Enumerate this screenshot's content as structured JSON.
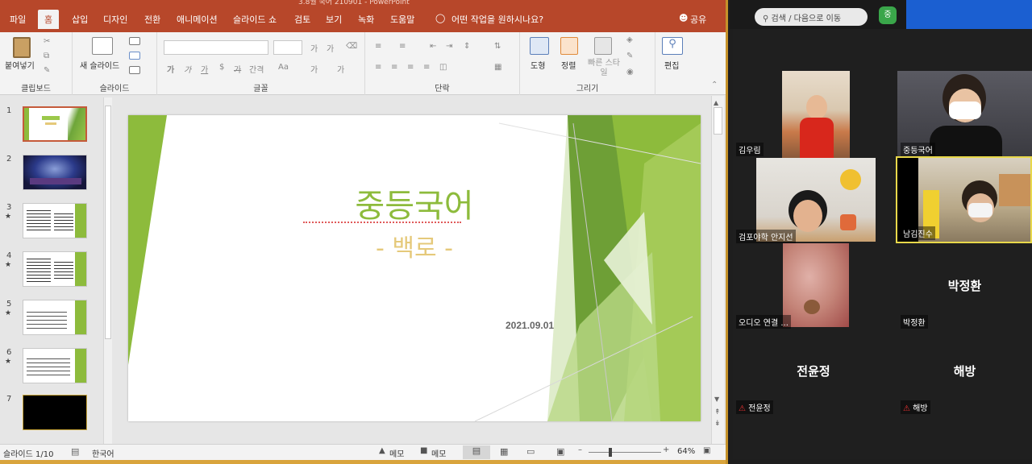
{
  "window": {
    "title": "3.8월 국어 210901  -  PowerPoint"
  },
  "tabs": [
    {
      "label": "파일"
    },
    {
      "label": "홈"
    },
    {
      "label": "삽입"
    },
    {
      "label": "디자인"
    },
    {
      "label": "전환"
    },
    {
      "label": "애니메이션"
    },
    {
      "label": "슬라이드 쇼"
    },
    {
      "label": "검토"
    },
    {
      "label": "보기"
    },
    {
      "label": "녹화"
    },
    {
      "label": "도움말"
    }
  ],
  "tell_me": "어떤 작업을 원하시나요?",
  "share": "공유",
  "ribbon": {
    "paste": "붙여넣기",
    "clipboard": "클립보드",
    "new_slide": "새 슬라이드",
    "slides": "슬라이드",
    "font": "글꼴",
    "paragraph": "단락",
    "shapes": "도형",
    "arrange": "정렬",
    "quick_styles": "빠른 스타일",
    "drawing": "그리기",
    "editing": "편집",
    "font_btns": [
      "가",
      "가",
      "가",
      "$",
      "가",
      "간격",
      "Aa",
      "가",
      "가"
    ]
  },
  "thumbnails": [
    {
      "num": "1",
      "star": ""
    },
    {
      "num": "2",
      "star": ""
    },
    {
      "num": "3",
      "star": "★"
    },
    {
      "num": "4",
      "star": "★"
    },
    {
      "num": "5",
      "star": "★"
    },
    {
      "num": "6",
      "star": "★"
    },
    {
      "num": "7",
      "star": ""
    }
  ],
  "slide": {
    "title": "중등국어",
    "subtitle": "- 백로 -",
    "date": "2021.09.01",
    "title_color": "#8dbb3c",
    "subtitle_color": "#e5c97a"
  },
  "status": {
    "slide_count": "슬라이드 1/10",
    "language": "한국어",
    "notes": "메모",
    "comments": "메모",
    "zoom": "64%"
  },
  "zoom": {
    "search": "검색 / 다음으로 이동",
    "participants": [
      {
        "name": "김우림",
        "video": true
      },
      {
        "name": "중등국어",
        "video": true
      },
      {
        "name": "검포야학 안지선",
        "video": true
      },
      {
        "name": "남김진수",
        "video": true
      },
      {
        "name": "오디오 연결 ...",
        "video": true
      },
      {
        "name": "박정환",
        "big": "박정환",
        "video": false
      },
      {
        "name": "전윤정",
        "big": "전윤정",
        "video": false,
        "muted": true
      },
      {
        "name": "해방",
        "big": "해방",
        "video": false,
        "muted": true
      }
    ]
  }
}
